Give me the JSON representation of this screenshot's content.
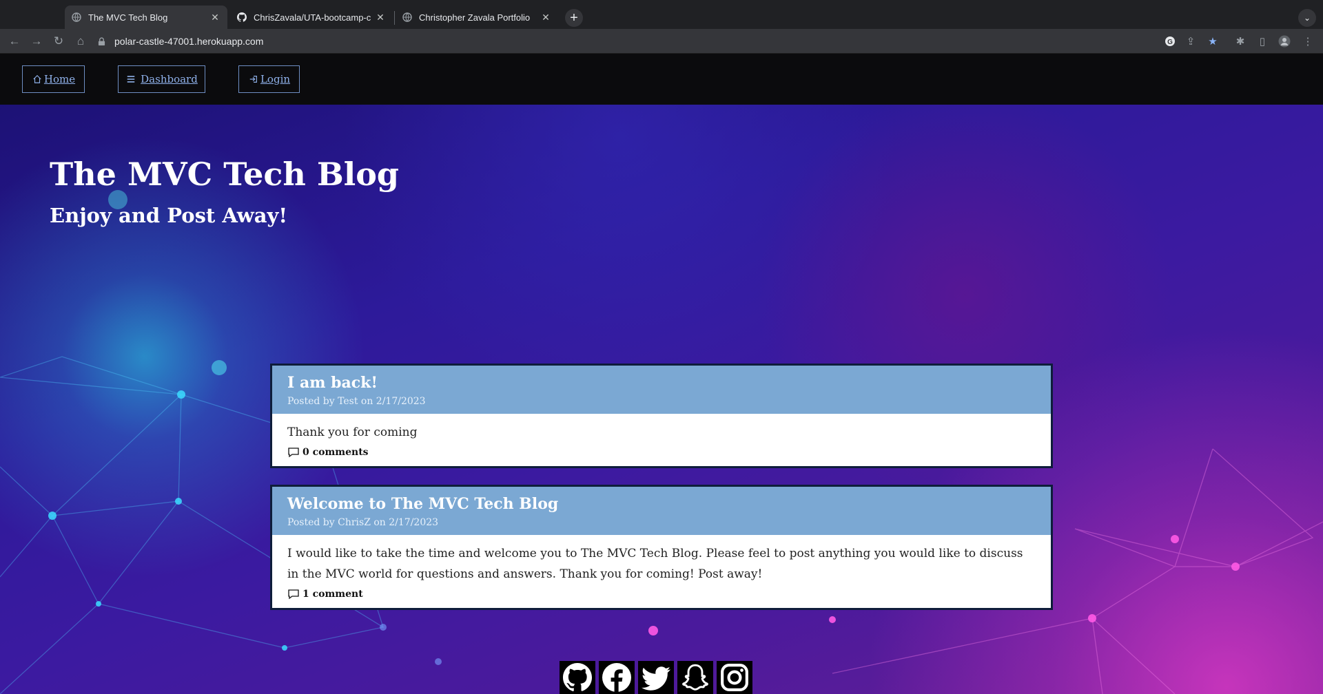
{
  "browser": {
    "tabs": [
      {
        "title": "The MVC Tech Blog",
        "active": true
      },
      {
        "title": "ChrisZavala/UTA-bootcamp-ch",
        "active": false
      },
      {
        "title": "Christopher Zavala Portfolio",
        "active": false
      }
    ],
    "url": "polar-castle-47001.herokuapp.com"
  },
  "site": {
    "nav": {
      "home_label": "Home",
      "dashboard_label": "Dashboard",
      "login_label": "Login"
    },
    "hero": {
      "title": "The MVC Tech Blog",
      "subtitle": "Enjoy and Post Away!"
    },
    "posts": [
      {
        "title": "I am back!",
        "meta": "Posted by Test on 2/17/2023",
        "body": "Thank you for coming",
        "comments": "0 comments"
      },
      {
        "title": "Welcome to The MVC Tech Blog",
        "meta": "Posted by ChrisZ on 2/17/2023",
        "body": "I would like to take the time and welcome you to The MVC Tech Blog. Please feel to post anything you would like to discuss in the MVC world for questions and answers. Thank you for coming! Post away!",
        "comments": "1 comment"
      }
    ],
    "social_icons": [
      "github-icon",
      "facebook-icon",
      "twitter-icon",
      "snapchat-icon",
      "instagram-icon"
    ]
  },
  "colors": {
    "nav_bg": "#0b0b0d",
    "nav_link": "#8fb1ea",
    "post_header": "#7ba8d3",
    "post_border": "#0e1d3a"
  }
}
